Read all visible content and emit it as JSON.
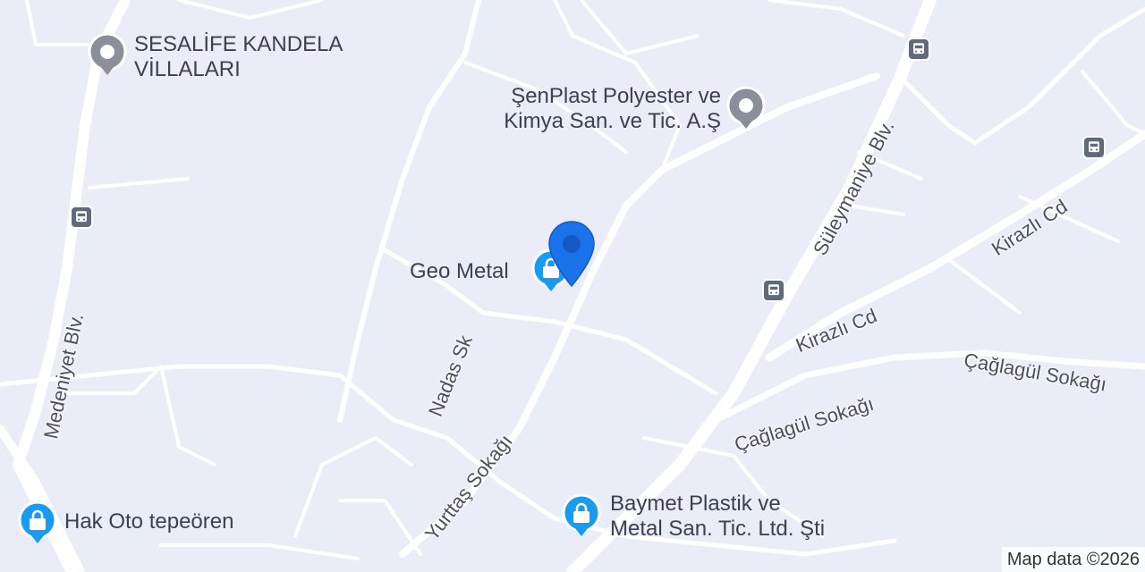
{
  "map": {
    "colors": {
      "background": "#eaedf7",
      "road": "#ffffff",
      "label": "#3c4150",
      "poi_gray": "#8a8f99",
      "poi_blue": "#1a9bf0",
      "pin_blue": "#1a73e8",
      "bus_icon": "#5f6b7c"
    },
    "places": {
      "sesalife_line1": "SESALİFE KANDELA",
      "sesalife_line2": "VİLLALARI",
      "senplast_line1": "ŞenPlast Polyester ve",
      "senplast_line2": "Kimya San. ve Tic. A.Ş",
      "geo_metal": "Geo Metal",
      "hak_oto": "Hak Oto tepeören",
      "baymet_line1": "Baymet Plastik ve",
      "baymet_line2": "Metal San. Tic. Ltd. Şti"
    },
    "roads": {
      "medeniyet": "Medeniyet Blv.",
      "suleymaniye": "Süleymaniye Blv.",
      "kirazli_1": "Kirazlı Cd",
      "kirazli_2": "Kirazlı Cd",
      "caglagul_1": "Çağlagül Sokağı",
      "caglagul_2": "Çağlagül Sokağı",
      "nadas": "Nadas Sk",
      "yurttas": "Yurttaş Sokağı"
    },
    "icons": {
      "place_gray": "place-pin-icon",
      "shopping": "shopping-bag-icon",
      "bus": "bus-stop-icon",
      "selected": "location-pin-icon"
    },
    "attribution": "Map data ©2026"
  }
}
